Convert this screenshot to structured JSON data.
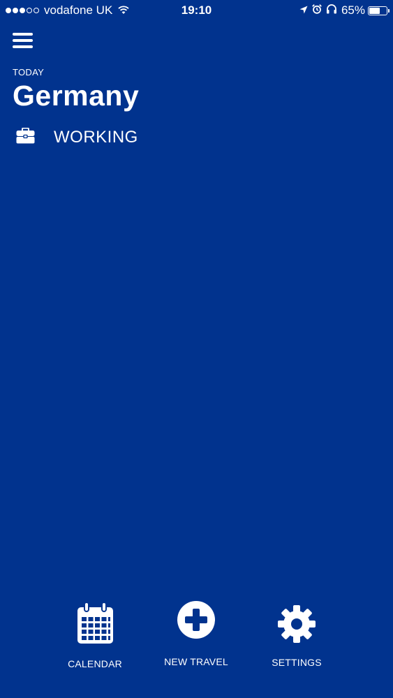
{
  "status_bar": {
    "carrier": "vodafone UK",
    "time": "19:10",
    "battery_text": "65%",
    "battery_level": 0.65,
    "signal_bars_filled": 3,
    "signal_bars_total": 5,
    "icons": [
      "wifi-icon",
      "location-arrow-icon",
      "alarm-icon",
      "headphones-icon",
      "battery-icon"
    ]
  },
  "header": {
    "menu_icon": "hamburger-menu-icon",
    "today_label": "TODAY",
    "country": "Germany"
  },
  "status": {
    "icon": "briefcase-icon",
    "label": "WORKING"
  },
  "tabs": [
    {
      "id": "calendar",
      "label": "CALENDAR",
      "icon": "calendar-icon"
    },
    {
      "id": "new-travel",
      "label": "NEW TRAVEL",
      "icon": "plus-circle-icon"
    },
    {
      "id": "settings",
      "label": "SETTINGS",
      "icon": "gear-icon"
    }
  ],
  "colors": {
    "background": "#01338e",
    "foreground": "#ffffff"
  }
}
